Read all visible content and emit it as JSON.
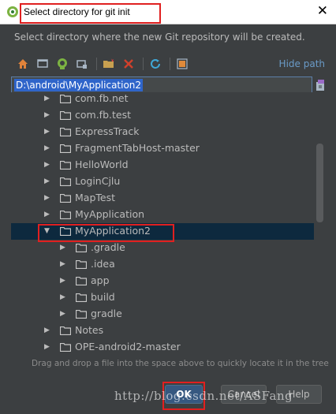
{
  "window": {
    "title": "Select directory for git init",
    "close_label": "✕"
  },
  "description": "Select directory where the new Git repository will be created.",
  "toolbar": {
    "hide_path_label": "Hide path",
    "buttons": [
      "home-icon",
      "desktop-icon",
      "android-project-icon",
      "module-icon",
      "new-folder-icon",
      "delete-icon",
      "refresh-icon",
      "show-hidden-icon"
    ]
  },
  "path": {
    "value": "D:\\android\\MyApplication2"
  },
  "tree": {
    "items": [
      {
        "label": "com.fb.net",
        "expanded": false,
        "depth": 0
      },
      {
        "label": "com.fb.test",
        "expanded": false,
        "depth": 0
      },
      {
        "label": "ExpressTrack",
        "expanded": false,
        "depth": 0
      },
      {
        "label": "FragmentTabHost-master",
        "expanded": false,
        "depth": 0
      },
      {
        "label": "HelloWorld",
        "expanded": false,
        "depth": 0
      },
      {
        "label": "LoginCjlu",
        "expanded": false,
        "depth": 0
      },
      {
        "label": "MapTest",
        "expanded": false,
        "depth": 0
      },
      {
        "label": "MyApplication",
        "expanded": false,
        "depth": 0
      },
      {
        "label": "MyApplication2",
        "expanded": true,
        "depth": 0,
        "selected": true
      },
      {
        "label": ".gradle",
        "expanded": false,
        "depth": 1
      },
      {
        "label": ".idea",
        "expanded": false,
        "depth": 1
      },
      {
        "label": "app",
        "expanded": false,
        "depth": 1
      },
      {
        "label": "build",
        "expanded": false,
        "depth": 1
      },
      {
        "label": "gradle",
        "expanded": false,
        "depth": 1
      },
      {
        "label": "Notes",
        "expanded": false,
        "depth": 0
      },
      {
        "label": "OPE-android2-master",
        "expanded": false,
        "depth": 0
      }
    ]
  },
  "hint": "Drag and drop a file into the space above to quickly locate it in the tree",
  "buttons": {
    "ok": "OK",
    "cancel": "Cancel",
    "help": "Help"
  },
  "watermark": "http://blog.csdn.net/ASFang",
  "colors": {
    "background": "#3c3f41",
    "selection": "#0d293e",
    "path_highlight": "#2f65ca",
    "link": "#6a9bc8",
    "annotation_red": "#e02020",
    "folder": "#c8c8c8"
  }
}
